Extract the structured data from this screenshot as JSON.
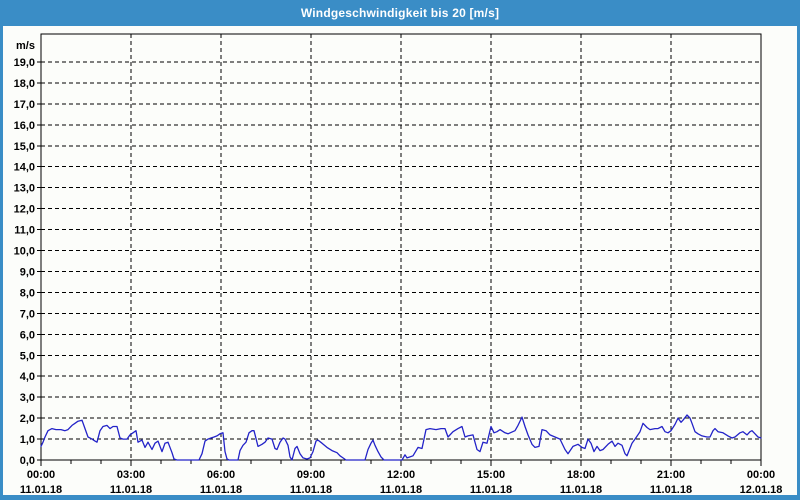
{
  "window": {
    "title": "Windgeschwindigkeit bis 20 [m/s]"
  },
  "colors": {
    "frame_blue": "#3a8dc6",
    "titlebar_text": "#ffffff",
    "plot_background": "#fcfdfa",
    "grid_color": "#000000",
    "line_color": "#2323c8"
  },
  "chart_data": {
    "type": "line",
    "title": "Windgeschwindigkeit bis 20 [m/s]",
    "y_unit_label": "m/s",
    "ylabel": "m/s",
    "xlabel": "",
    "ylim": [
      0,
      20.3
    ],
    "grid": {
      "horizontal": "dashed black every 1.0 m/s",
      "vertical": "dashed black every 3 h"
    },
    "legend_position": "none",
    "y_axis": {
      "tick_step": 1.0,
      "tick_values": [
        0,
        1,
        2,
        3,
        4,
        5,
        6,
        7,
        8,
        9,
        10,
        11,
        12,
        13,
        14,
        15,
        16,
        17,
        18,
        19
      ],
      "tick_labels": [
        "0,0",
        "1,0",
        "2,0",
        "3,0",
        "4,0",
        "5,0",
        "6,0",
        "7,0",
        "8,0",
        "9,0",
        "10,0",
        "11,0",
        "12,0",
        "13,0",
        "14,0",
        "15,0",
        "16,0",
        "17,0",
        "18,0",
        "19,0"
      ]
    },
    "x_axis": {
      "range_minutes": [
        0,
        1440
      ],
      "minor_tick_minutes": 60,
      "major_ticks": [
        {
          "m": 0,
          "time": "00:00",
          "date": "11.01.18"
        },
        {
          "m": 180,
          "time": "03:00",
          "date": "11.01.18"
        },
        {
          "m": 360,
          "time": "06:00",
          "date": "11.01.18"
        },
        {
          "m": 540,
          "time": "09:00",
          "date": "11.01.18"
        },
        {
          "m": 720,
          "time": "12:00",
          "date": "11.01.18"
        },
        {
          "m": 900,
          "time": "15:00",
          "date": "11.01.18"
        },
        {
          "m": 1080,
          "time": "18:00",
          "date": "11.01.18"
        },
        {
          "m": 1260,
          "time": "21:00",
          "date": "11.01.18"
        },
        {
          "m": 1440,
          "time": "00:00",
          "date": "12.01.18"
        }
      ]
    },
    "series": [
      {
        "name": "Windgeschwindigkeit",
        "unit": "m/s",
        "points": [
          [
            0,
            0.65
          ],
          [
            4,
            0.85
          ],
          [
            8,
            1.1
          ],
          [
            14,
            1.4
          ],
          [
            22,
            1.5
          ],
          [
            30,
            1.45
          ],
          [
            40,
            1.45
          ],
          [
            48,
            1.4
          ],
          [
            54,
            1.45
          ],
          [
            62,
            1.65
          ],
          [
            68,
            1.75
          ],
          [
            74,
            1.85
          ],
          [
            82,
            1.9
          ],
          [
            88,
            1.5
          ],
          [
            94,
            1.1
          ],
          [
            102,
            1.0
          ],
          [
            108,
            0.9
          ],
          [
            112,
            0.85
          ],
          [
            118,
            1.4
          ],
          [
            124,
            1.6
          ],
          [
            132,
            1.65
          ],
          [
            138,
            1.5
          ],
          [
            144,
            1.6
          ],
          [
            152,
            1.6
          ],
          [
            158,
            1.05
          ],
          [
            164,
            1.0
          ],
          [
            172,
            1.0
          ],
          [
            178,
            1.2
          ],
          [
            184,
            1.3
          ],
          [
            190,
            1.4
          ],
          [
            194,
            0.85
          ],
          [
            202,
            0.95
          ],
          [
            208,
            0.6
          ],
          [
            214,
            0.85
          ],
          [
            222,
            0.5
          ],
          [
            228,
            0.8
          ],
          [
            234,
            0.9
          ],
          [
            242,
            0.4
          ],
          [
            248,
            0.8
          ],
          [
            254,
            0.85
          ],
          [
            262,
            0.35
          ],
          [
            266,
            0.05
          ],
          [
            272,
            0
          ],
          [
            316,
            0
          ],
          [
            322,
            0.3
          ],
          [
            328,
            0.9
          ],
          [
            334,
            1.0
          ],
          [
            340,
            1.05
          ],
          [
            346,
            1.1
          ],
          [
            352,
            1.15
          ],
          [
            358,
            1.25
          ],
          [
            364,
            1.3
          ],
          [
            368,
            0.4
          ],
          [
            372,
            0.05
          ],
          [
            376,
            0
          ],
          [
            394,
            0
          ],
          [
            398,
            0.45
          ],
          [
            404,
            0.7
          ],
          [
            410,
            0.85
          ],
          [
            416,
            1.3
          ],
          [
            422,
            1.4
          ],
          [
            426,
            1.4
          ],
          [
            434,
            0.65
          ],
          [
            442,
            0.75
          ],
          [
            448,
            0.85
          ],
          [
            454,
            1.05
          ],
          [
            462,
            1.0
          ],
          [
            468,
            0.55
          ],
          [
            472,
            0.5
          ],
          [
            478,
            0.85
          ],
          [
            484,
            1.05
          ],
          [
            488,
            1.0
          ],
          [
            494,
            0.7
          ],
          [
            498,
            0.15
          ],
          [
            502,
            0
          ],
          [
            508,
            0.55
          ],
          [
            512,
            0.65
          ],
          [
            518,
            0.3
          ],
          [
            524,
            0.1
          ],
          [
            532,
            0.05
          ],
          [
            538,
            0.1
          ],
          [
            544,
            0.4
          ],
          [
            550,
            0.9
          ],
          [
            554,
            0.95
          ],
          [
            562,
            0.8
          ],
          [
            572,
            0.6
          ],
          [
            582,
            0.45
          ],
          [
            592,
            0.35
          ],
          [
            598,
            0.2
          ],
          [
            604,
            0.1
          ],
          [
            610,
            0
          ],
          [
            648,
            0
          ],
          [
            654,
            0.5
          ],
          [
            660,
            0.8
          ],
          [
            664,
            0.95
          ],
          [
            668,
            0.7
          ],
          [
            674,
            0.4
          ],
          [
            680,
            0.15
          ],
          [
            686,
            0
          ],
          [
            722,
            0
          ],
          [
            728,
            0.25
          ],
          [
            732,
            0.1
          ],
          [
            738,
            0.15
          ],
          [
            744,
            0.2
          ],
          [
            754,
            0.6
          ],
          [
            762,
            0.55
          ],
          [
            770,
            1.45
          ],
          [
            778,
            1.5
          ],
          [
            790,
            1.45
          ],
          [
            800,
            1.5
          ],
          [
            808,
            1.5
          ],
          [
            814,
            1.1
          ],
          [
            824,
            1.35
          ],
          [
            834,
            1.5
          ],
          [
            842,
            1.6
          ],
          [
            848,
            1.1
          ],
          [
            854,
            1.15
          ],
          [
            864,
            1.2
          ],
          [
            872,
            0.5
          ],
          [
            878,
            0.4
          ],
          [
            884,
            0.85
          ],
          [
            892,
            0.8
          ],
          [
            900,
            1.6
          ],
          [
            906,
            1.3
          ],
          [
            912,
            1.35
          ],
          [
            918,
            1.45
          ],
          [
            928,
            1.3
          ],
          [
            934,
            1.25
          ],
          [
            948,
            1.4
          ],
          [
            954,
            1.65
          ],
          [
            962,
            2.05
          ],
          [
            968,
            1.6
          ],
          [
            974,
            1.2
          ],
          [
            982,
            0.75
          ],
          [
            988,
            0.6
          ],
          [
            996,
            0.65
          ],
          [
            1002,
            1.45
          ],
          [
            1010,
            1.4
          ],
          [
            1018,
            1.2
          ],
          [
            1028,
            1.1
          ],
          [
            1038,
            1.0
          ],
          [
            1048,
            0.5
          ],
          [
            1054,
            0.3
          ],
          [
            1064,
            0.65
          ],
          [
            1074,
            0.75
          ],
          [
            1082,
            0.6
          ],
          [
            1088,
            0.55
          ],
          [
            1094,
            1.0
          ],
          [
            1100,
            0.8
          ],
          [
            1106,
            0.4
          ],
          [
            1112,
            0.65
          ],
          [
            1118,
            0.45
          ],
          [
            1124,
            0.5
          ],
          [
            1134,
            0.75
          ],
          [
            1142,
            0.9
          ],
          [
            1148,
            0.65
          ],
          [
            1154,
            0.8
          ],
          [
            1162,
            0.7
          ],
          [
            1168,
            0.3
          ],
          [
            1172,
            0.2
          ],
          [
            1182,
            0.8
          ],
          [
            1188,
            1.0
          ],
          [
            1198,
            1.35
          ],
          [
            1204,
            1.75
          ],
          [
            1212,
            1.55
          ],
          [
            1218,
            1.45
          ],
          [
            1228,
            1.5
          ],
          [
            1234,
            1.5
          ],
          [
            1242,
            1.6
          ],
          [
            1248,
            1.35
          ],
          [
            1254,
            1.3
          ],
          [
            1260,
            1.4
          ],
          [
            1268,
            1.7
          ],
          [
            1274,
            2.0
          ],
          [
            1280,
            1.8
          ],
          [
            1284,
            1.9
          ],
          [
            1292,
            2.15
          ],
          [
            1298,
            2.0
          ],
          [
            1302,
            1.75
          ],
          [
            1308,
            1.35
          ],
          [
            1314,
            1.25
          ],
          [
            1322,
            1.15
          ],
          [
            1332,
            1.1
          ],
          [
            1338,
            1.1
          ],
          [
            1344,
            1.4
          ],
          [
            1348,
            1.5
          ],
          [
            1354,
            1.35
          ],
          [
            1364,
            1.3
          ],
          [
            1374,
            1.15
          ],
          [
            1382,
            1.05
          ],
          [
            1388,
            1.1
          ],
          [
            1398,
            1.3
          ],
          [
            1404,
            1.35
          ],
          [
            1412,
            1.2
          ],
          [
            1418,
            1.35
          ],
          [
            1422,
            1.4
          ],
          [
            1428,
            1.25
          ],
          [
            1434,
            1.1
          ],
          [
            1440,
            1.05
          ]
        ]
      }
    ]
  }
}
